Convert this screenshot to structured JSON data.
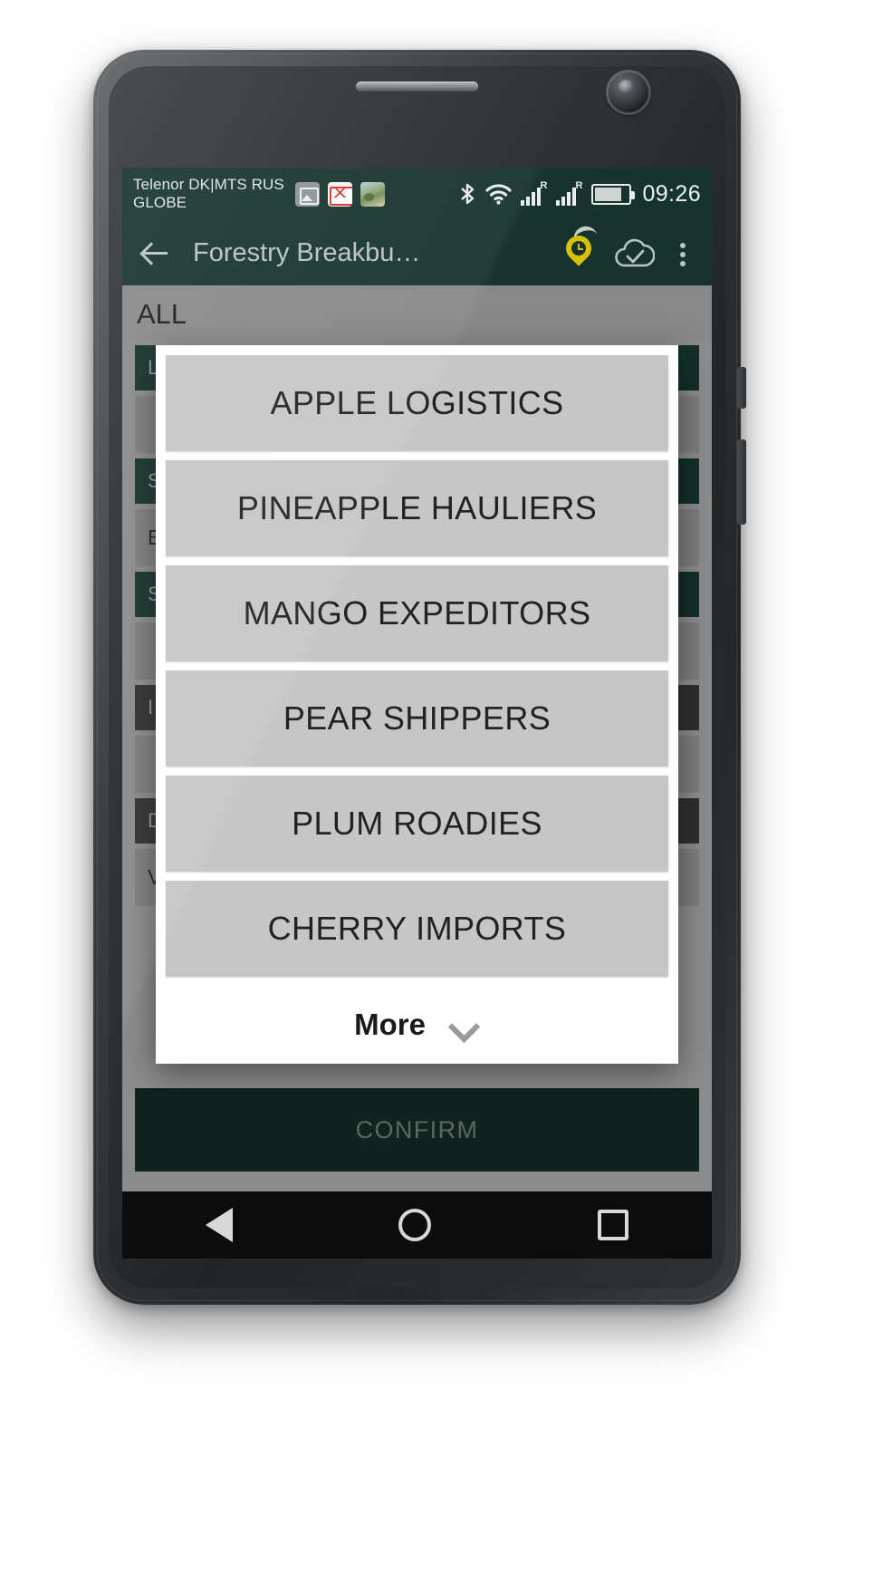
{
  "statusbar": {
    "carrier_line1": "Telenor DK|MTS RUS",
    "carrier_line2": "GLOBE",
    "clock": "09:26",
    "notification_icons": [
      "image-icon",
      "gmail-icon",
      "photos-icon"
    ],
    "system_icons": [
      "bluetooth-icon",
      "wifi-icon",
      "signal-roaming-1-icon",
      "signal-roaming-2-icon",
      "battery-icon"
    ],
    "roaming_label": "R",
    "background_color": "#16332d"
  },
  "toolbar": {
    "back_label": "back-arrow",
    "title": "Forestry Breakbu…",
    "actions": [
      "pin-clock-icon",
      "cloud-check-icon",
      "overflow-menu"
    ],
    "background_color": "#16332d",
    "title_color": "#b9c3c0",
    "pin_color": "#d6c009"
  },
  "background": {
    "section_title": "ALL",
    "rows": [
      {
        "style": "chip-dark",
        "text": "L"
      },
      {
        "style": "chip-grey",
        "text": ""
      },
      {
        "style": "chip-dark",
        "text": "S"
      },
      {
        "style": "chip-grey",
        "text": "B"
      },
      {
        "style": "chip-dark",
        "text": "S"
      },
      {
        "style": "chip-grey",
        "text": ""
      },
      {
        "style": "chip-charcoal",
        "text": "I"
      },
      {
        "style": "chip-grey",
        "text": ""
      },
      {
        "style": "chip-charcoal",
        "text": "D"
      },
      {
        "style": "chip-grey",
        "text": "V"
      }
    ],
    "confirm_label": "CONFIRM"
  },
  "dialog": {
    "options": [
      "APPLE LOGISTICS",
      "PINEAPPLE HAULIERS",
      "MANGO EXPEDITORS",
      "PEAR SHIPPERS",
      "PLUM ROADIES",
      "CHERRY IMPORTS"
    ],
    "more_label": "More",
    "more_icon": "chevron-down-icon",
    "option_background": "#c6c6c6"
  },
  "navbar": {
    "items": [
      "nav-back-icon",
      "nav-home-icon",
      "nav-recents-icon"
    ],
    "background_color": "#0c0c0c"
  }
}
